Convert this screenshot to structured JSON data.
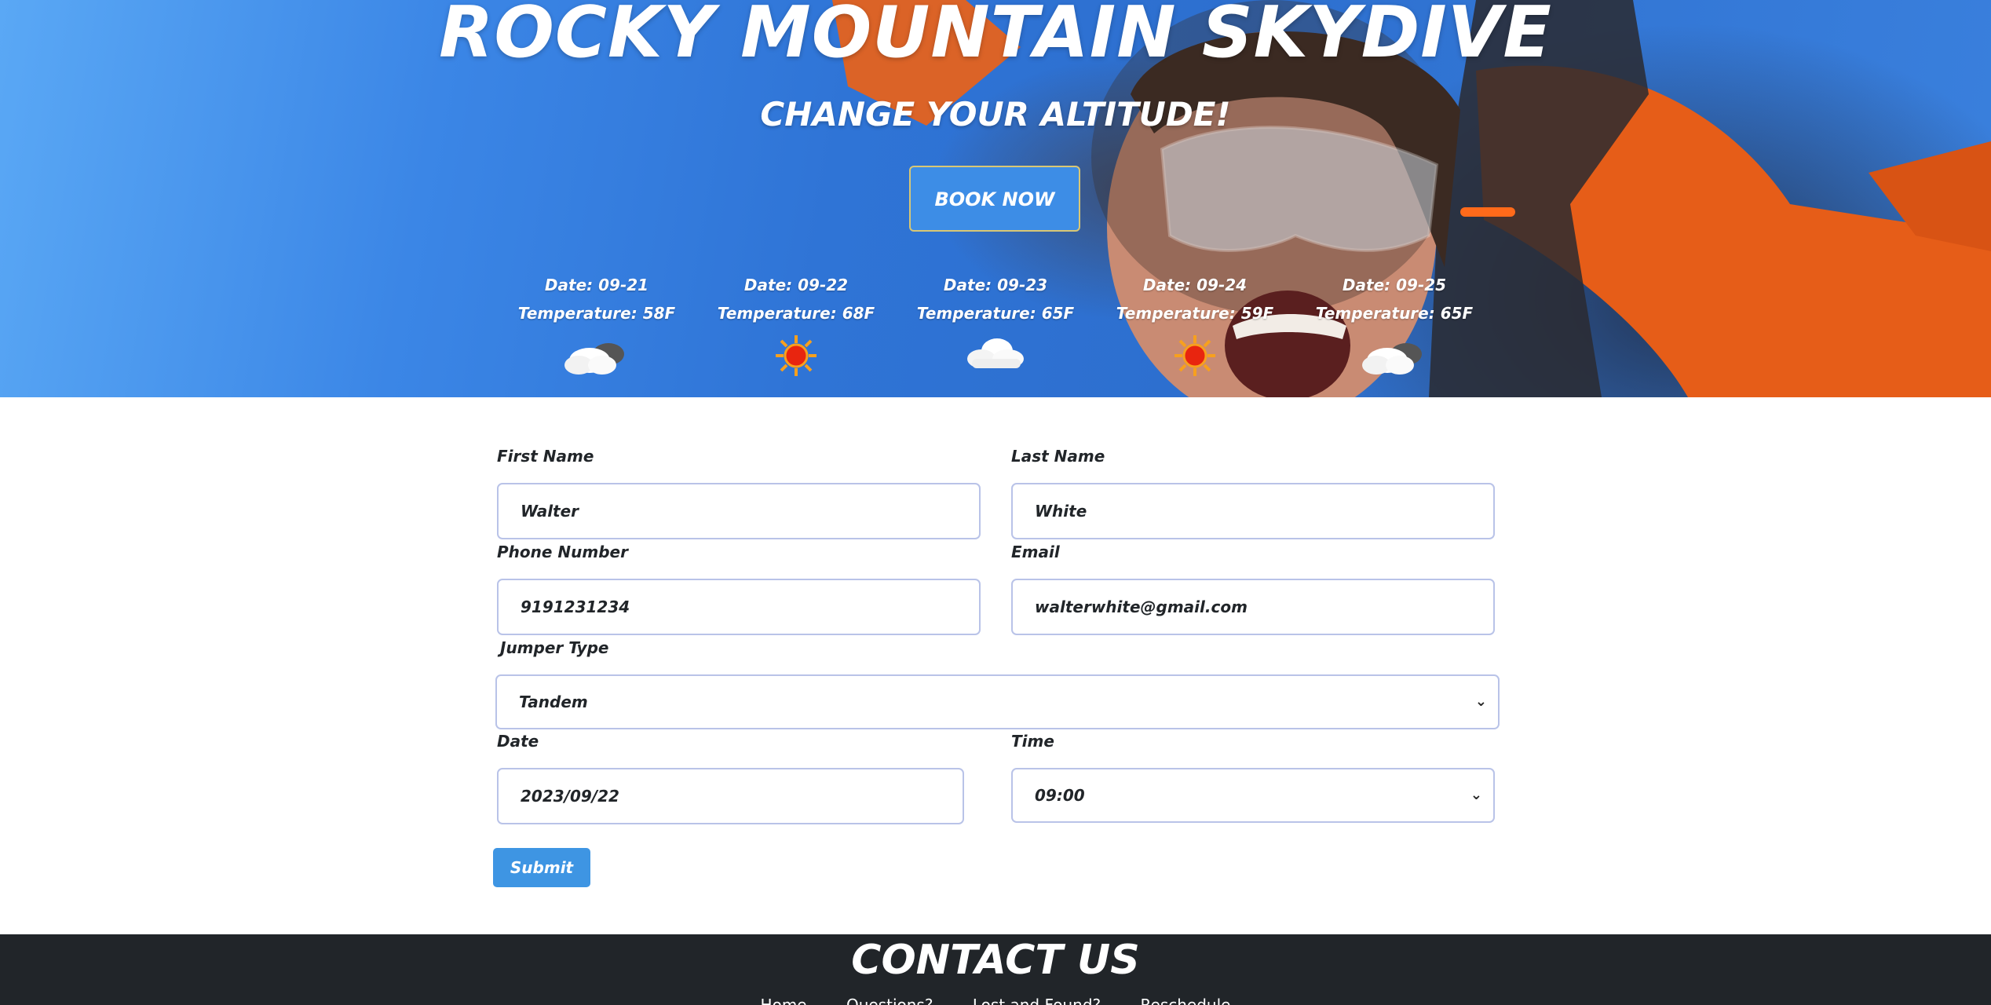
{
  "hero": {
    "title": "ROCKY MOUNTAIN SKYDIVE",
    "subtitle": "CHANGE YOUR ALTITUDE!",
    "book_button": "BOOK NOW",
    "forecast": [
      {
        "date": "Date: 09-21",
        "temp": "Temperature: 58F",
        "icon": "partly-cloudy-icon"
      },
      {
        "date": "Date: 09-22",
        "temp": "Temperature: 68F",
        "icon": "sun-icon"
      },
      {
        "date": "Date: 09-23",
        "temp": "Temperature: 65F",
        "icon": "cloud-icon"
      },
      {
        "date": "Date: 09-24",
        "temp": "Temperature: 59F",
        "icon": "sun-icon"
      },
      {
        "date": "Date: 09-25",
        "temp": "Temperature: 65F",
        "icon": "partly-cloudy-icon"
      }
    ]
  },
  "form": {
    "first_name": {
      "label": "First Name",
      "value": "Walter"
    },
    "last_name": {
      "label": "Last Name",
      "value": "White"
    },
    "phone": {
      "label": "Phone Number",
      "value": "9191231234"
    },
    "email": {
      "label": "Email",
      "value": "walterwhite@gmail.com"
    },
    "jumper_type": {
      "label": "Jumper Type",
      "value": "Tandem"
    },
    "date": {
      "label": "Date",
      "value": "2023/09/22"
    },
    "time": {
      "label": "Time",
      "value": "09:00"
    },
    "submit": "Submit"
  },
  "footer": {
    "title": "CONTACT US",
    "links": [
      "Home",
      "Questions?",
      "Lost and Found?",
      "Reschedule"
    ]
  },
  "colors": {
    "accent": "#3e95e3",
    "footer_bg": "#212529",
    "field_border": "#b9c3e8"
  }
}
